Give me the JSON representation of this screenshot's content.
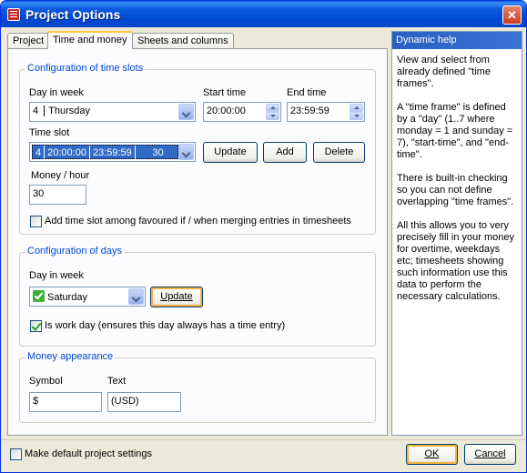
{
  "window": {
    "title": "Project Options",
    "close_glyph": "✕"
  },
  "tabs": [
    {
      "label": "Project"
    },
    {
      "label": "Time and money"
    },
    {
      "label": "Sheets and columns"
    }
  ],
  "time_slots": {
    "group_title": "Configuration of time slots",
    "day_label": "Day in week",
    "day_number": "4",
    "day_value": "Thursday",
    "start_label": "Start time",
    "start_value": "20:00:00",
    "end_label": "End time",
    "end_value": "23:59:59",
    "slot_label": "Time slot",
    "slot_cells": [
      "4",
      "20:00:00",
      "23:59:59",
      "30"
    ],
    "update_label": "Update",
    "add_label": "Add",
    "delete_label": "Delete",
    "money_label": "Money / hour",
    "money_value": "30",
    "favoured_label": "Add time slot among favoured if / when merging entries in timesheets",
    "favoured_checked": false
  },
  "days": {
    "group_title": "Configuration of days",
    "day_label": "Day in week",
    "day_value": "Saturday",
    "update_label": "Update",
    "workday_label": "Is work day (ensures this day always has a time entry)",
    "workday_checked": true
  },
  "money": {
    "group_title": "Money appearance",
    "symbol_label": "Symbol",
    "symbol_value": "$",
    "text_label": "Text",
    "text_value": "(USD)"
  },
  "help": {
    "title": "Dynamic help",
    "paragraphs": [
      "View and select from already defined \"time frames\".",
      "A \"time frame\" is defined by a \"day\" (1..7 where monday = 1 and sunday = 7), \"start-time\", and \"end-time\".",
      "There is built-in checking so you can not define overlapping \"time frames\".",
      "All this allows you to very precisely fill in your money for overtime, weekdays etc; timesheets showing such information use this data to perform the necessary calculations."
    ]
  },
  "footer": {
    "default_label": "Make default project settings",
    "default_checked": false,
    "ok_label": "OK",
    "cancel_label": "Cancel"
  },
  "colors": {
    "titlebar": "#0a5be0",
    "group_title": "#0046d5",
    "selection": "#316ac5",
    "focus": "#ffc83c"
  }
}
